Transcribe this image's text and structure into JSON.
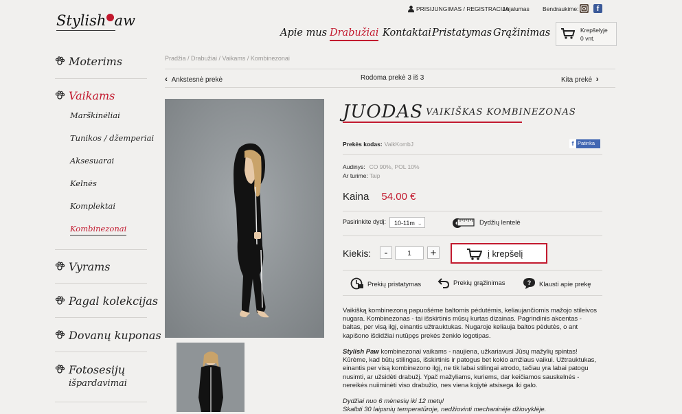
{
  "topbar": {
    "login": "PRISIJUNGIMAS / REGISTRACIJA",
    "loyalty": "Lojalumas",
    "share": "Bendraukime:",
    "instagram_icon": "instagram-icon",
    "facebook_icon": "facebook-icon"
  },
  "logo": {
    "text": "Stylish",
    "text2": "aw"
  },
  "nav": {
    "items": [
      "Apie mus",
      "Drabužiai",
      "Kontaktai",
      "Pristatymas",
      "Grąžinimas"
    ],
    "active": "Drabužiai"
  },
  "cart": {
    "title": "Krepšelyje",
    "count": "0 vnt."
  },
  "sidebar": {
    "categories": [
      "Moterims",
      "Vaikams",
      "Vyrams",
      "Pagal kolekcijas",
      "Dovanų kuponas",
      "Fotosesijų",
      "išpardavimai"
    ],
    "subcategories": [
      "Marškinėliai",
      "Tunikos / džemperiai",
      "Aksesuarai",
      "Kelnės",
      "Komplektai",
      "Kombinezonai"
    ],
    "active_category": "Vaikams",
    "active_sub": "Kombinezonai"
  },
  "breadcrumb": "Pradžia / Drabužiai / Vaikams / Kombinezonai",
  "pager": {
    "prev": "Ankstesnė prekė",
    "status": "Rodoma prekė 3 iš 3",
    "next": "Kita prekė"
  },
  "product": {
    "title_big": "JUODAS",
    "title_small": "VAIKIŠKAS KOMBINEZONAS",
    "code_label": "Prekės kodas:",
    "code_value": "VaikKombJ",
    "like": "Patinka",
    "fabric_label": "Audinys:",
    "fabric_value": "CO 90%, POL 10%",
    "stock_label": "Ar turime:",
    "stock_value": "Taip",
    "price_label": "Kaina",
    "price_value": "54.00 €",
    "size_label": "Pasirinkite dydį:",
    "size_value": "10-11m",
    "size_table": "Dydžių lentelė",
    "qty_label": "Kiekis:",
    "qty_minus": "-",
    "qty_value": "1",
    "qty_plus": "+",
    "add_to_cart": "į krepšelį",
    "service_delivery": "Prekių pristatymas",
    "service_return": "Prekių grąžinimas",
    "service_ask": "Klausti apie prekę"
  },
  "description": {
    "p1": "Vaikišką kombinezoną papuošėme baltomis pėdutėmis, keliaujančiomis mažojo stileivos nugara. Kombinezonas - tai išskirtinis mūsų kurtas dizainas. Pagrindinis akcentas - baltas, per visą ilgį, einantis užtrauktukas. Nugaroje keliauja baltos pėdutės, o ant kapišono išdidžiai nutūpęs prekės ženklo logotipas.",
    "p2_brand": "Stylish Paw",
    "p2": " kombinezonai vaikams - naujiena, užkariavusi Jūsų mažylių spintas! Kūrėme, kad būtų stilingas, išskirtinis ir patogus bet kokio amžiaus vaikui. Užtrauktukas, einantis per visą kombinezono ilgį, ne tik labai stilingai atrodo, tačiau yra labai patogu nusimti, ar užsidėti drabužį. Ypač mažyliams, kuriems, dar keičiamos sauskelnės - nereikės nuiiminėti viso drabužio, nes viena kojytė atsisega iki galo.",
    "p3a": "Dydžiai nuo 6 mėnesių iki 12 metų!",
    "p3b": "Skalbti 30 laipsnių temperatūroje, nedžiovinti mechaninėje džiovyklėje."
  },
  "colors": {
    "accent": "#c2192e",
    "background": "#f1f0ee"
  }
}
